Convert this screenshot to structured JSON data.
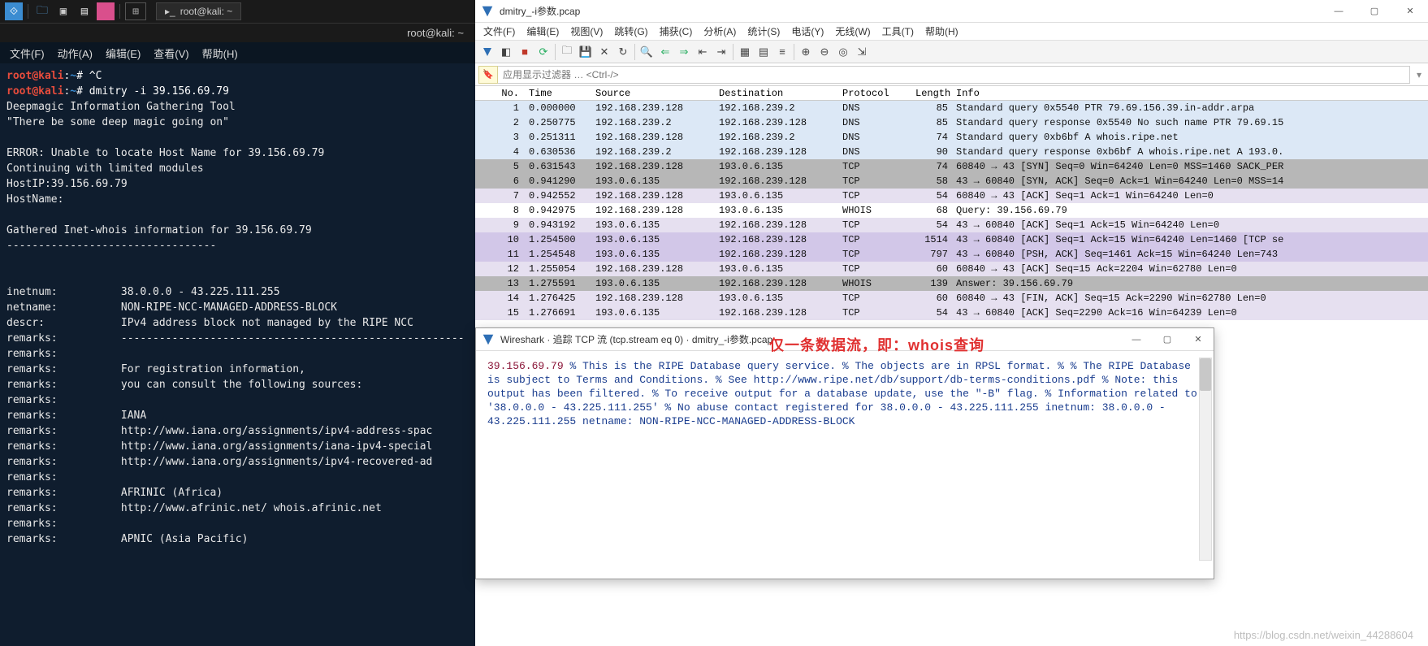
{
  "kali": {
    "task_title": "root@kali: ~",
    "window_title": "root@kali: ~",
    "menu": [
      "文件(F)",
      "动作(A)",
      "编辑(E)",
      "查看(V)",
      "帮助(H)"
    ],
    "prompt": {
      "user": "root",
      "host": "kali",
      "path": "~",
      "symbol": "#"
    },
    "cmd1": "^C",
    "cmd2": "dmitry -i 39.156.69.79",
    "out": [
      "Deepmagic Information Gathering Tool",
      "\"There be some deep magic going on\"",
      "",
      "ERROR: Unable to locate Host Name for 39.156.69.79",
      "Continuing with limited modules",
      "HostIP:39.156.69.79",
      "HostName:",
      "",
      "Gathered Inet-whois information for 39.156.69.79",
      "---------------------------------",
      "",
      ""
    ],
    "whois": [
      [
        "inetnum:",
        "38.0.0.0 - 43.225.111.255"
      ],
      [
        "netname:",
        "NON-RIPE-NCC-MANAGED-ADDRESS-BLOCK"
      ],
      [
        "descr:",
        "IPv4 address block not managed by the RIPE NCC"
      ],
      [
        "remarks:",
        "------------------------------------------------------"
      ],
      [
        "remarks:",
        ""
      ],
      [
        "remarks:",
        "For registration information,"
      ],
      [
        "remarks:",
        "you can consult the following sources:"
      ],
      [
        "remarks:",
        ""
      ],
      [
        "remarks:",
        "IANA"
      ],
      [
        "remarks:",
        "http://www.iana.org/assignments/ipv4-address-spac"
      ],
      [
        "remarks:",
        "http://www.iana.org/assignments/iana-ipv4-special"
      ],
      [
        "remarks:",
        "http://www.iana.org/assignments/ipv4-recovered-ad"
      ],
      [
        "remarks:",
        ""
      ],
      [
        "remarks:",
        "AFRINIC (Africa)"
      ],
      [
        "remarks:",
        "http://www.afrinic.net/ whois.afrinic.net"
      ],
      [
        "remarks:",
        ""
      ],
      [
        "remarks:",
        "APNIC (Asia Pacific)"
      ]
    ]
  },
  "ws": {
    "title": "dmitry_-i参数.pcap",
    "menu": [
      "文件(F)",
      "编辑(E)",
      "视图(V)",
      "跳转(G)",
      "捕获(C)",
      "分析(A)",
      "统计(S)",
      "电话(Y)",
      "无线(W)",
      "工具(T)",
      "帮助(H)"
    ],
    "filter_placeholder": "应用显示过滤器 … <Ctrl-/>",
    "cols": [
      "No.",
      "Time",
      "Source",
      "Destination",
      "Protocol",
      "Length",
      "Info"
    ],
    "rows": [
      {
        "no": "1",
        "t": "0.000000",
        "s": "192.168.239.128",
        "d": "192.168.239.2",
        "p": "DNS",
        "l": "85",
        "i": "Standard query 0x5540 PTR 79.69.156.39.in-addr.arpa",
        "c": "dns"
      },
      {
        "no": "2",
        "t": "0.250775",
        "s": "192.168.239.2",
        "d": "192.168.239.128",
        "p": "DNS",
        "l": "85",
        "i": "Standard query response 0x5540 No such name PTR 79.69.15",
        "c": "dns"
      },
      {
        "no": "3",
        "t": "0.251311",
        "s": "192.168.239.128",
        "d": "192.168.239.2",
        "p": "DNS",
        "l": "74",
        "i": "Standard query 0xb6bf A whois.ripe.net",
        "c": "dns"
      },
      {
        "no": "4",
        "t": "0.630536",
        "s": "192.168.239.2",
        "d": "192.168.239.128",
        "p": "DNS",
        "l": "90",
        "i": "Standard query response 0xb6bf A whois.ripe.net A 193.0.",
        "c": "dns"
      },
      {
        "no": "5",
        "t": "0.631543",
        "s": "192.168.239.128",
        "d": "193.0.6.135",
        "p": "TCP",
        "l": "74",
        "i": "60840 → 43 [SYN] Seq=0 Win=64240 Len=0 MSS=1460 SACK_PER",
        "c": "tcpg"
      },
      {
        "no": "6",
        "t": "0.941290",
        "s": "193.0.6.135",
        "d": "192.168.239.128",
        "p": "TCP",
        "l": "58",
        "i": "43 → 60840 [SYN, ACK] Seq=0 Ack=1 Win=64240 Len=0 MSS=14",
        "c": "tcpg"
      },
      {
        "no": "7",
        "t": "0.942552",
        "s": "192.168.239.128",
        "d": "193.0.6.135",
        "p": "TCP",
        "l": "54",
        "i": "60840 → 43 [ACK] Seq=1 Ack=1 Win=64240 Len=0",
        "c": "tcp"
      },
      {
        "no": "8",
        "t": "0.942975",
        "s": "192.168.239.128",
        "d": "193.0.6.135",
        "p": "WHOIS",
        "l": "68",
        "i": "Query: 39.156.69.79",
        "c": "whois"
      },
      {
        "no": "9",
        "t": "0.943192",
        "s": "193.0.6.135",
        "d": "192.168.239.128",
        "p": "TCP",
        "l": "54",
        "i": "43 → 60840 [ACK] Seq=1 Ack=15 Win=64240 Len=0",
        "c": "tcp"
      },
      {
        "no": "10",
        "t": "1.254500",
        "s": "193.0.6.135",
        "d": "192.168.239.128",
        "p": "TCP",
        "l": "1514",
        "i": "43 → 60840 [ACK] Seq=1 Ack=15 Win=64240 Len=1460 [TCP se",
        "c": "resel"
      },
      {
        "no": "11",
        "t": "1.254548",
        "s": "193.0.6.135",
        "d": "192.168.239.128",
        "p": "TCP",
        "l": "797",
        "i": "43 → 60840 [PSH, ACK] Seq=1461 Ack=15 Win=64240 Len=743",
        "c": "resel"
      },
      {
        "no": "12",
        "t": "1.255054",
        "s": "192.168.239.128",
        "d": "193.0.6.135",
        "p": "TCP",
        "l": "60",
        "i": "60840 → 43 [ACK] Seq=15 Ack=2204 Win=62780 Len=0",
        "c": "tcp"
      },
      {
        "no": "13",
        "t": "1.275591",
        "s": "193.0.6.135",
        "d": "192.168.239.128",
        "p": "WHOIS",
        "l": "139",
        "i": "Answer: 39.156.69.79",
        "c": "tcpg"
      },
      {
        "no": "14",
        "t": "1.276425",
        "s": "192.168.239.128",
        "d": "193.0.6.135",
        "p": "TCP",
        "l": "60",
        "i": "60840 → 43 [FIN, ACK] Seq=15 Ack=2290 Win=62780 Len=0",
        "c": "tcp"
      },
      {
        "no": "15",
        "t": "1.276691",
        "s": "193.0.6.135",
        "d": "192.168.239.128",
        "p": "TCP",
        "l": "54",
        "i": "43 → 60840 [ACK] Seq=2290 Ack=16 Win=64239 Len=0",
        "c": "tcp"
      }
    ]
  },
  "follow": {
    "title": "Wireshark · 追踪 TCP 流 (tcp.stream eq 0) · dmitry_-i参数.pcap",
    "annot": "仅一条数据流，即：whois查询",
    "client": "39.156.69.79",
    "server": [
      "% This is the RIPE Database query service.",
      "% The objects are in RPSL format.",
      "%",
      "% The RIPE Database is subject to Terms and Conditions.",
      "% See http://www.ripe.net/db/support/db-terms-conditions.pdf",
      "",
      "% Note: this output has been filtered.",
      "%       To receive output for a database update, use the \"-B\" flag.",
      "",
      "% Information related to '38.0.0.0 - 43.225.111.255'",
      "",
      "% No abuse contact registered for 38.0.0.0 - 43.225.111.255",
      "",
      "inetnum:        38.0.0.0 - 43.225.111.255",
      "netname:        NON-RIPE-NCC-MANAGED-ADDRESS-BLOCK"
    ]
  },
  "watermark": "https://blog.csdn.net/weixin_44288604"
}
